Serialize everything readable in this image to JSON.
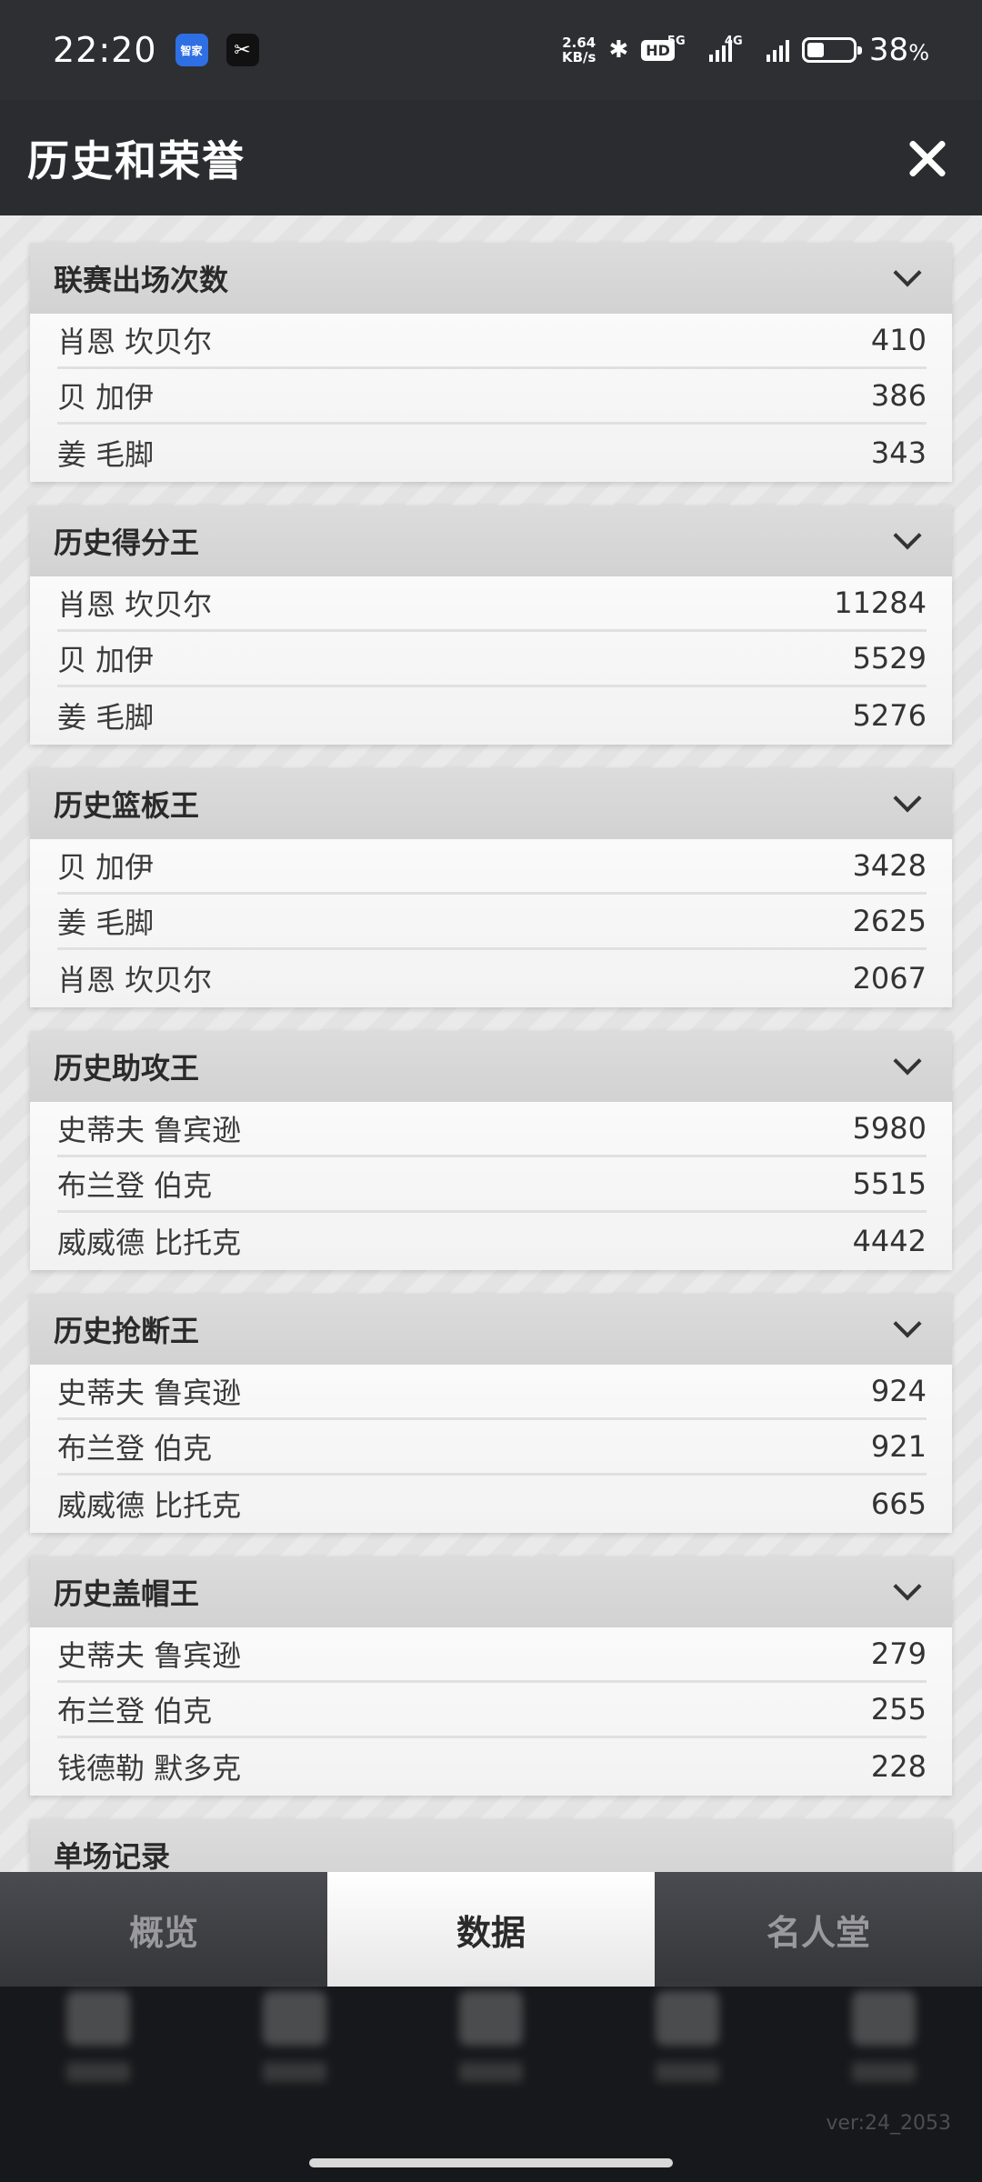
{
  "status_bar": {
    "time": "22:20",
    "net_speed_value": "2.64",
    "net_speed_unit": "KB/s",
    "hd_label": "HD",
    "signal1_label": "5G",
    "signal2_label": "4G",
    "battery_percent": "38",
    "battery_unit": "%",
    "battery_level": 0.38,
    "app_icon_1": "智家",
    "app_icon_2": "✂"
  },
  "header": {
    "title": "历史和荣誉",
    "close_icon": "close-icon"
  },
  "sections": [
    {
      "title": "联赛出场次数",
      "rows": [
        {
          "name": "肖恩 坎贝尔",
          "value": "410"
        },
        {
          "name": "贝 加伊",
          "value": "386"
        },
        {
          "name": "姜 毛脚",
          "value": "343"
        }
      ]
    },
    {
      "title": "历史得分王",
      "rows": [
        {
          "name": "肖恩 坎贝尔",
          "value": "11284"
        },
        {
          "name": "贝 加伊",
          "value": "5529"
        },
        {
          "name": "姜 毛脚",
          "value": "5276"
        }
      ]
    },
    {
      "title": "历史篮板王",
      "rows": [
        {
          "name": "贝 加伊",
          "value": "3428"
        },
        {
          "name": "姜 毛脚",
          "value": "2625"
        },
        {
          "name": "肖恩 坎贝尔",
          "value": "2067"
        }
      ]
    },
    {
      "title": "历史助攻王",
      "rows": [
        {
          "name": "史蒂夫 鲁宾逊",
          "value": "5980"
        },
        {
          "name": "布兰登 伯克",
          "value": "5515"
        },
        {
          "name": "威威德 比托克",
          "value": "4442"
        }
      ]
    },
    {
      "title": "历史抢断王",
      "rows": [
        {
          "name": "史蒂夫 鲁宾逊",
          "value": "924"
        },
        {
          "name": "布兰登 伯克",
          "value": "921"
        },
        {
          "name": "威威德 比托克",
          "value": "665"
        }
      ]
    },
    {
      "title": "历史盖帽王",
      "rows": [
        {
          "name": "史蒂夫 鲁宾逊",
          "value": "279"
        },
        {
          "name": "布兰登 伯克",
          "value": "255"
        },
        {
          "name": "钱德勒 默多克",
          "value": "228"
        }
      ]
    },
    {
      "title": "单场记录",
      "rows": []
    }
  ],
  "tabs": [
    {
      "label": "概览",
      "active": false
    },
    {
      "label": "数据",
      "active": true
    },
    {
      "label": "名人堂",
      "active": false
    }
  ],
  "version": "ver:24_2053",
  "colors": {
    "header_bg": "#2b2c30",
    "section_header_bg": "#d6d6d6",
    "active_tab_bg": "#ffffff",
    "inactive_tab_text": "#9a9a9e"
  }
}
